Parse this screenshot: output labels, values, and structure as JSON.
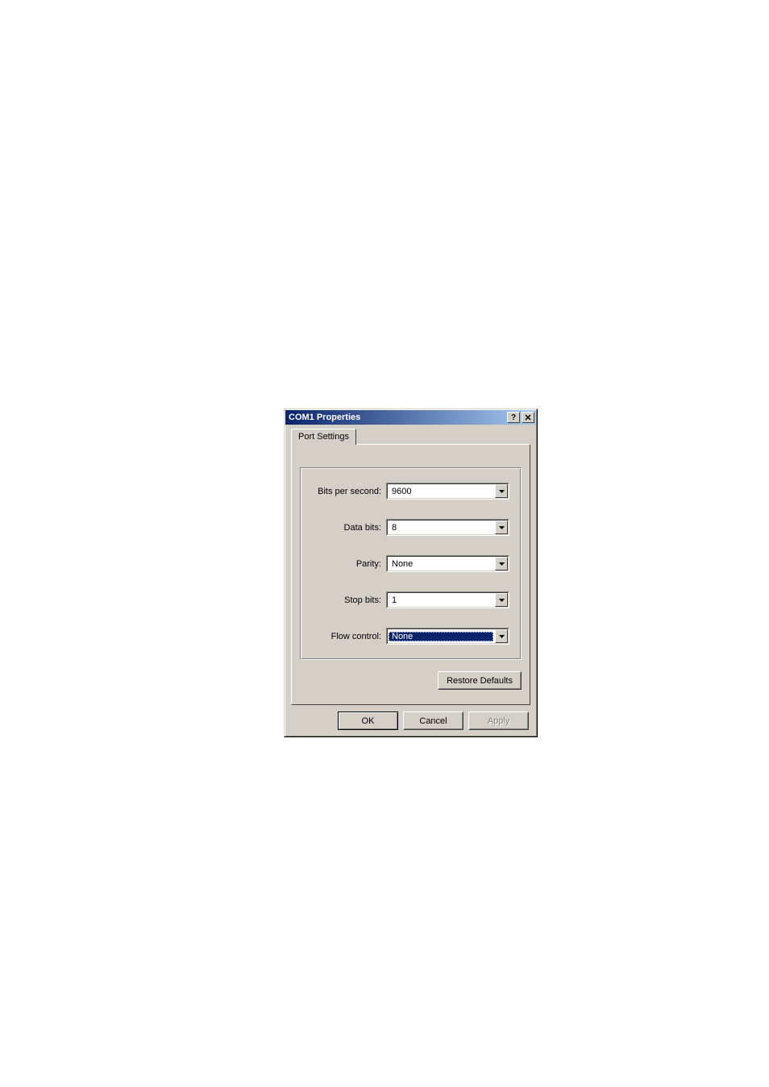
{
  "dialog": {
    "title": "COM1 Properties"
  },
  "tabs": {
    "port_settings": "Port Settings"
  },
  "fields": {
    "bits_per_second": {
      "label": "Bits per second:",
      "value": "9600"
    },
    "data_bits": {
      "label": "Data bits:",
      "value": "8"
    },
    "parity": {
      "label": "Parity:",
      "value": "None"
    },
    "stop_bits": {
      "label": "Stop bits:",
      "value": "1"
    },
    "flow_control": {
      "label": "Flow control:",
      "value": "None"
    }
  },
  "buttons": {
    "restore_defaults": "Restore Defaults",
    "ok": "OK",
    "cancel": "Cancel",
    "apply": "Apply"
  }
}
